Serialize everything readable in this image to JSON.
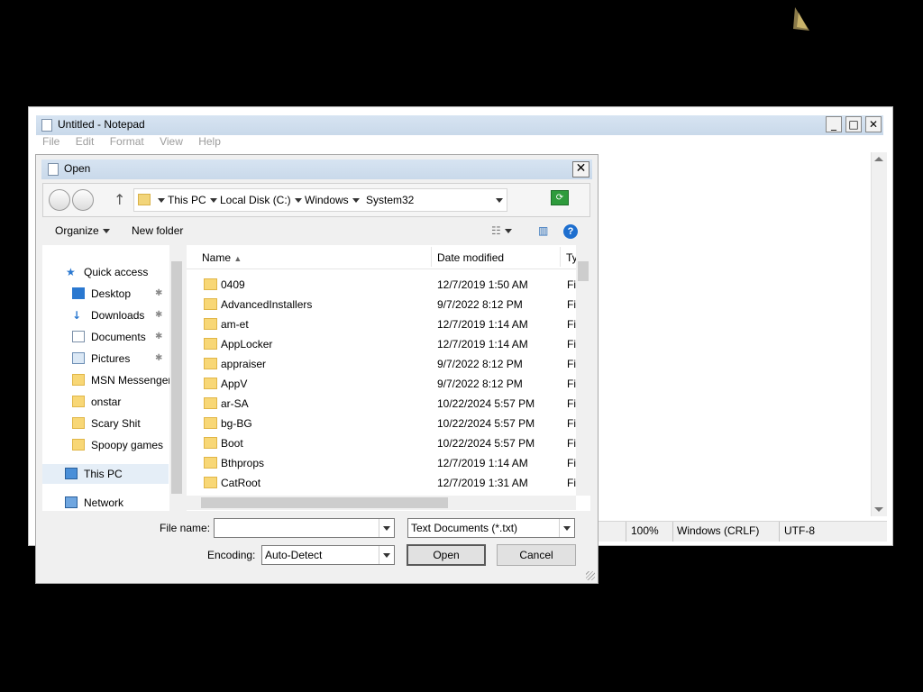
{
  "notepad": {
    "title": "Untitled - Notepad",
    "menu": [
      "File",
      "Edit",
      "Format",
      "View",
      "Help"
    ],
    "status": {
      "zoom": "100%",
      "line_ending": "Windows (CRLF)",
      "encoding": "UTF-8"
    }
  },
  "dialog": {
    "title": "Open",
    "breadcrumb": [
      "This PC",
      "Local Disk (C:)",
      "Windows",
      "System32"
    ],
    "organize_label": "Organize",
    "new_folder_label": "New folder",
    "nav": [
      {
        "label": "Quick access",
        "icon": "star-icon"
      },
      {
        "label": "Desktop",
        "icon": "desktop-icon",
        "pinned": true
      },
      {
        "label": "Downloads",
        "icon": "download-icon",
        "pinned": true
      },
      {
        "label": "Documents",
        "icon": "documents-icon",
        "pinned": true
      },
      {
        "label": "Pictures",
        "icon": "pictures-icon",
        "pinned": true
      },
      {
        "label": "MSN Messenger",
        "icon": "folder-icon"
      },
      {
        "label": "onstar",
        "icon": "folder-icon"
      },
      {
        "label": "Scary Shit",
        "icon": "folder-icon"
      },
      {
        "label": "Spoopy games",
        "icon": "folder-icon"
      },
      {
        "label": "This PC",
        "icon": "computer-icon"
      },
      {
        "label": "Network",
        "icon": "network-icon"
      }
    ],
    "columns": {
      "name": "Name",
      "date": "Date modified",
      "type": "Ty"
    },
    "files": [
      {
        "name": "0409",
        "date": "12/7/2019 1:50 AM",
        "type": "Fi"
      },
      {
        "name": "AdvancedInstallers",
        "date": "9/7/2022 8:12 PM",
        "type": "Fi"
      },
      {
        "name": "am-et",
        "date": "12/7/2019 1:14 AM",
        "type": "Fi"
      },
      {
        "name": "AppLocker",
        "date": "12/7/2019 1:14 AM",
        "type": "Fi"
      },
      {
        "name": "appraiser",
        "date": "9/7/2022 8:12 PM",
        "type": "Fi"
      },
      {
        "name": "AppV",
        "date": "9/7/2022 8:12 PM",
        "type": "Fi"
      },
      {
        "name": "ar-SA",
        "date": "10/22/2024 5:57 PM",
        "type": "Fi"
      },
      {
        "name": "bg-BG",
        "date": "10/22/2024 5:57 PM",
        "type": "Fi"
      },
      {
        "name": "Boot",
        "date": "10/22/2024 5:57 PM",
        "type": "Fi"
      },
      {
        "name": "Bthprops",
        "date": "12/7/2019 1:14 AM",
        "type": "Fi"
      },
      {
        "name": "CatRoot",
        "date": "12/7/2019 1:31 AM",
        "type": "Fi"
      }
    ],
    "file_name_label": "File name:",
    "file_name_value": "",
    "file_type": "Text Documents (*.txt)",
    "encoding_label": "Encoding:",
    "encoding_value": "Auto-Detect",
    "open_label": "Open",
    "cancel_label": "Cancel"
  }
}
